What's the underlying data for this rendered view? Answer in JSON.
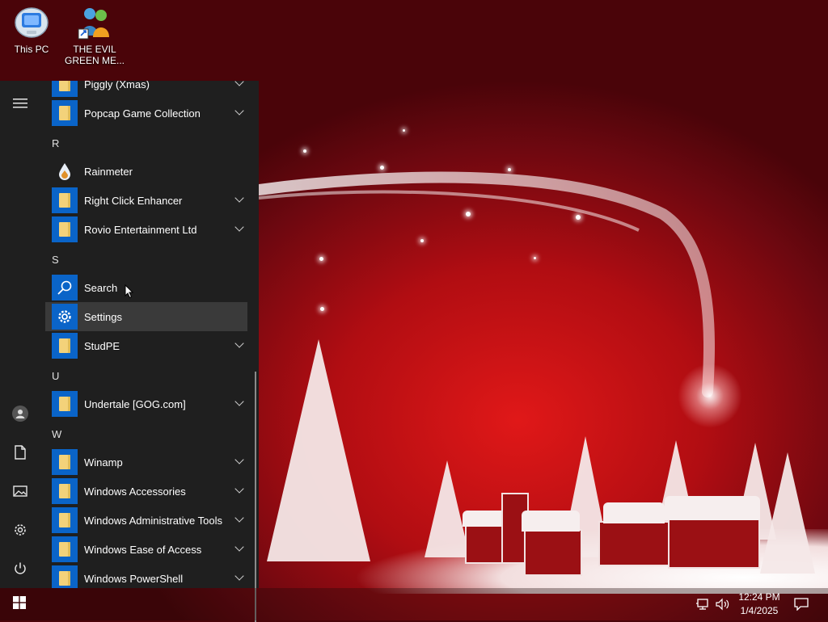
{
  "desktop": {
    "icons": [
      {
        "label": "This PC",
        "icon": "this-pc-icon"
      },
      {
        "label": "THE EVIL GREEN ME...",
        "icon": "messenger-shortcut-icon"
      }
    ]
  },
  "start_menu": {
    "rail_icons": [
      "hamburger-menu-icon",
      "user-avatar-icon",
      "documents-icon",
      "pictures-icon",
      "settings-gear-icon",
      "power-icon"
    ],
    "apps": [
      {
        "label": "Piggly (Xmas)",
        "type": "folder",
        "expandable": true
      },
      {
        "label": "Popcap Game Collection",
        "type": "folder",
        "expandable": true
      },
      {
        "letter": "R"
      },
      {
        "label": "Rainmeter",
        "type": "rainmeter",
        "expandable": false
      },
      {
        "label": "Right Click Enhancer",
        "type": "folder",
        "expandable": true
      },
      {
        "label": "Rovio Entertainment Ltd",
        "type": "folder",
        "expandable": true
      },
      {
        "letter": "S"
      },
      {
        "label": "Search",
        "type": "search",
        "expandable": false
      },
      {
        "label": "Settings",
        "type": "settings",
        "expandable": false,
        "highlighted": true
      },
      {
        "label": "StudPE",
        "type": "folder",
        "expandable": true
      },
      {
        "letter": "U"
      },
      {
        "label": "Undertale [GOG.com]",
        "type": "folder",
        "expandable": true
      },
      {
        "letter": "W"
      },
      {
        "label": "Winamp",
        "type": "folder",
        "expandable": true
      },
      {
        "label": "Windows Accessories",
        "type": "folder",
        "expandable": true
      },
      {
        "label": "Windows Administrative Tools",
        "type": "folder",
        "expandable": true
      },
      {
        "label": "Windows Ease of Access",
        "type": "folder",
        "expandable": true
      },
      {
        "label": "Windows PowerShell",
        "type": "folder",
        "expandable": true
      }
    ]
  },
  "taskbar": {
    "start_icon": "windows-logo-icon",
    "tray_icons": [
      "network-icon",
      "volume-icon"
    ],
    "time": "12:24 PM",
    "date": "1/4/2025",
    "notification_icon": "action-center-icon"
  },
  "colors": {
    "tile_blue": "#0a64c8",
    "menu_bg": "#1f1f1f",
    "wallpaper_red": "#b10d12"
  }
}
